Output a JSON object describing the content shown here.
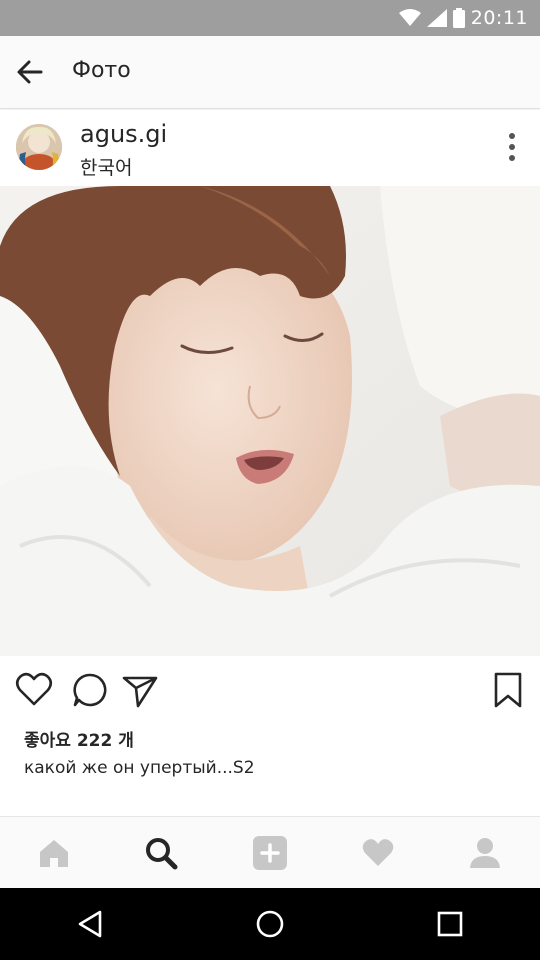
{
  "status_bar": {
    "time": "20:11",
    "icons": [
      "wifi-icon",
      "signal-icon",
      "battery-icon"
    ]
  },
  "header": {
    "title": "Фото",
    "back_icon": "arrow-left-icon"
  },
  "post": {
    "username": "agus.gi",
    "location": "한국어",
    "more_icon": "more-vertical-icon",
    "photo": "sleeping-person-photo",
    "likes": "좋아요 222 개",
    "caption": "какой же он упертый...S2"
  },
  "actions": [
    "heart-icon",
    "comment-icon",
    "send-icon",
    "bookmark-icon"
  ],
  "tabs": [
    "home-icon",
    "search-icon",
    "add-icon",
    "activity-heart-icon",
    "profile-icon"
  ],
  "colors": {
    "status_bar": "#9e9e9e",
    "text": "#262626",
    "inactive_tab": "#c7c7c7"
  }
}
